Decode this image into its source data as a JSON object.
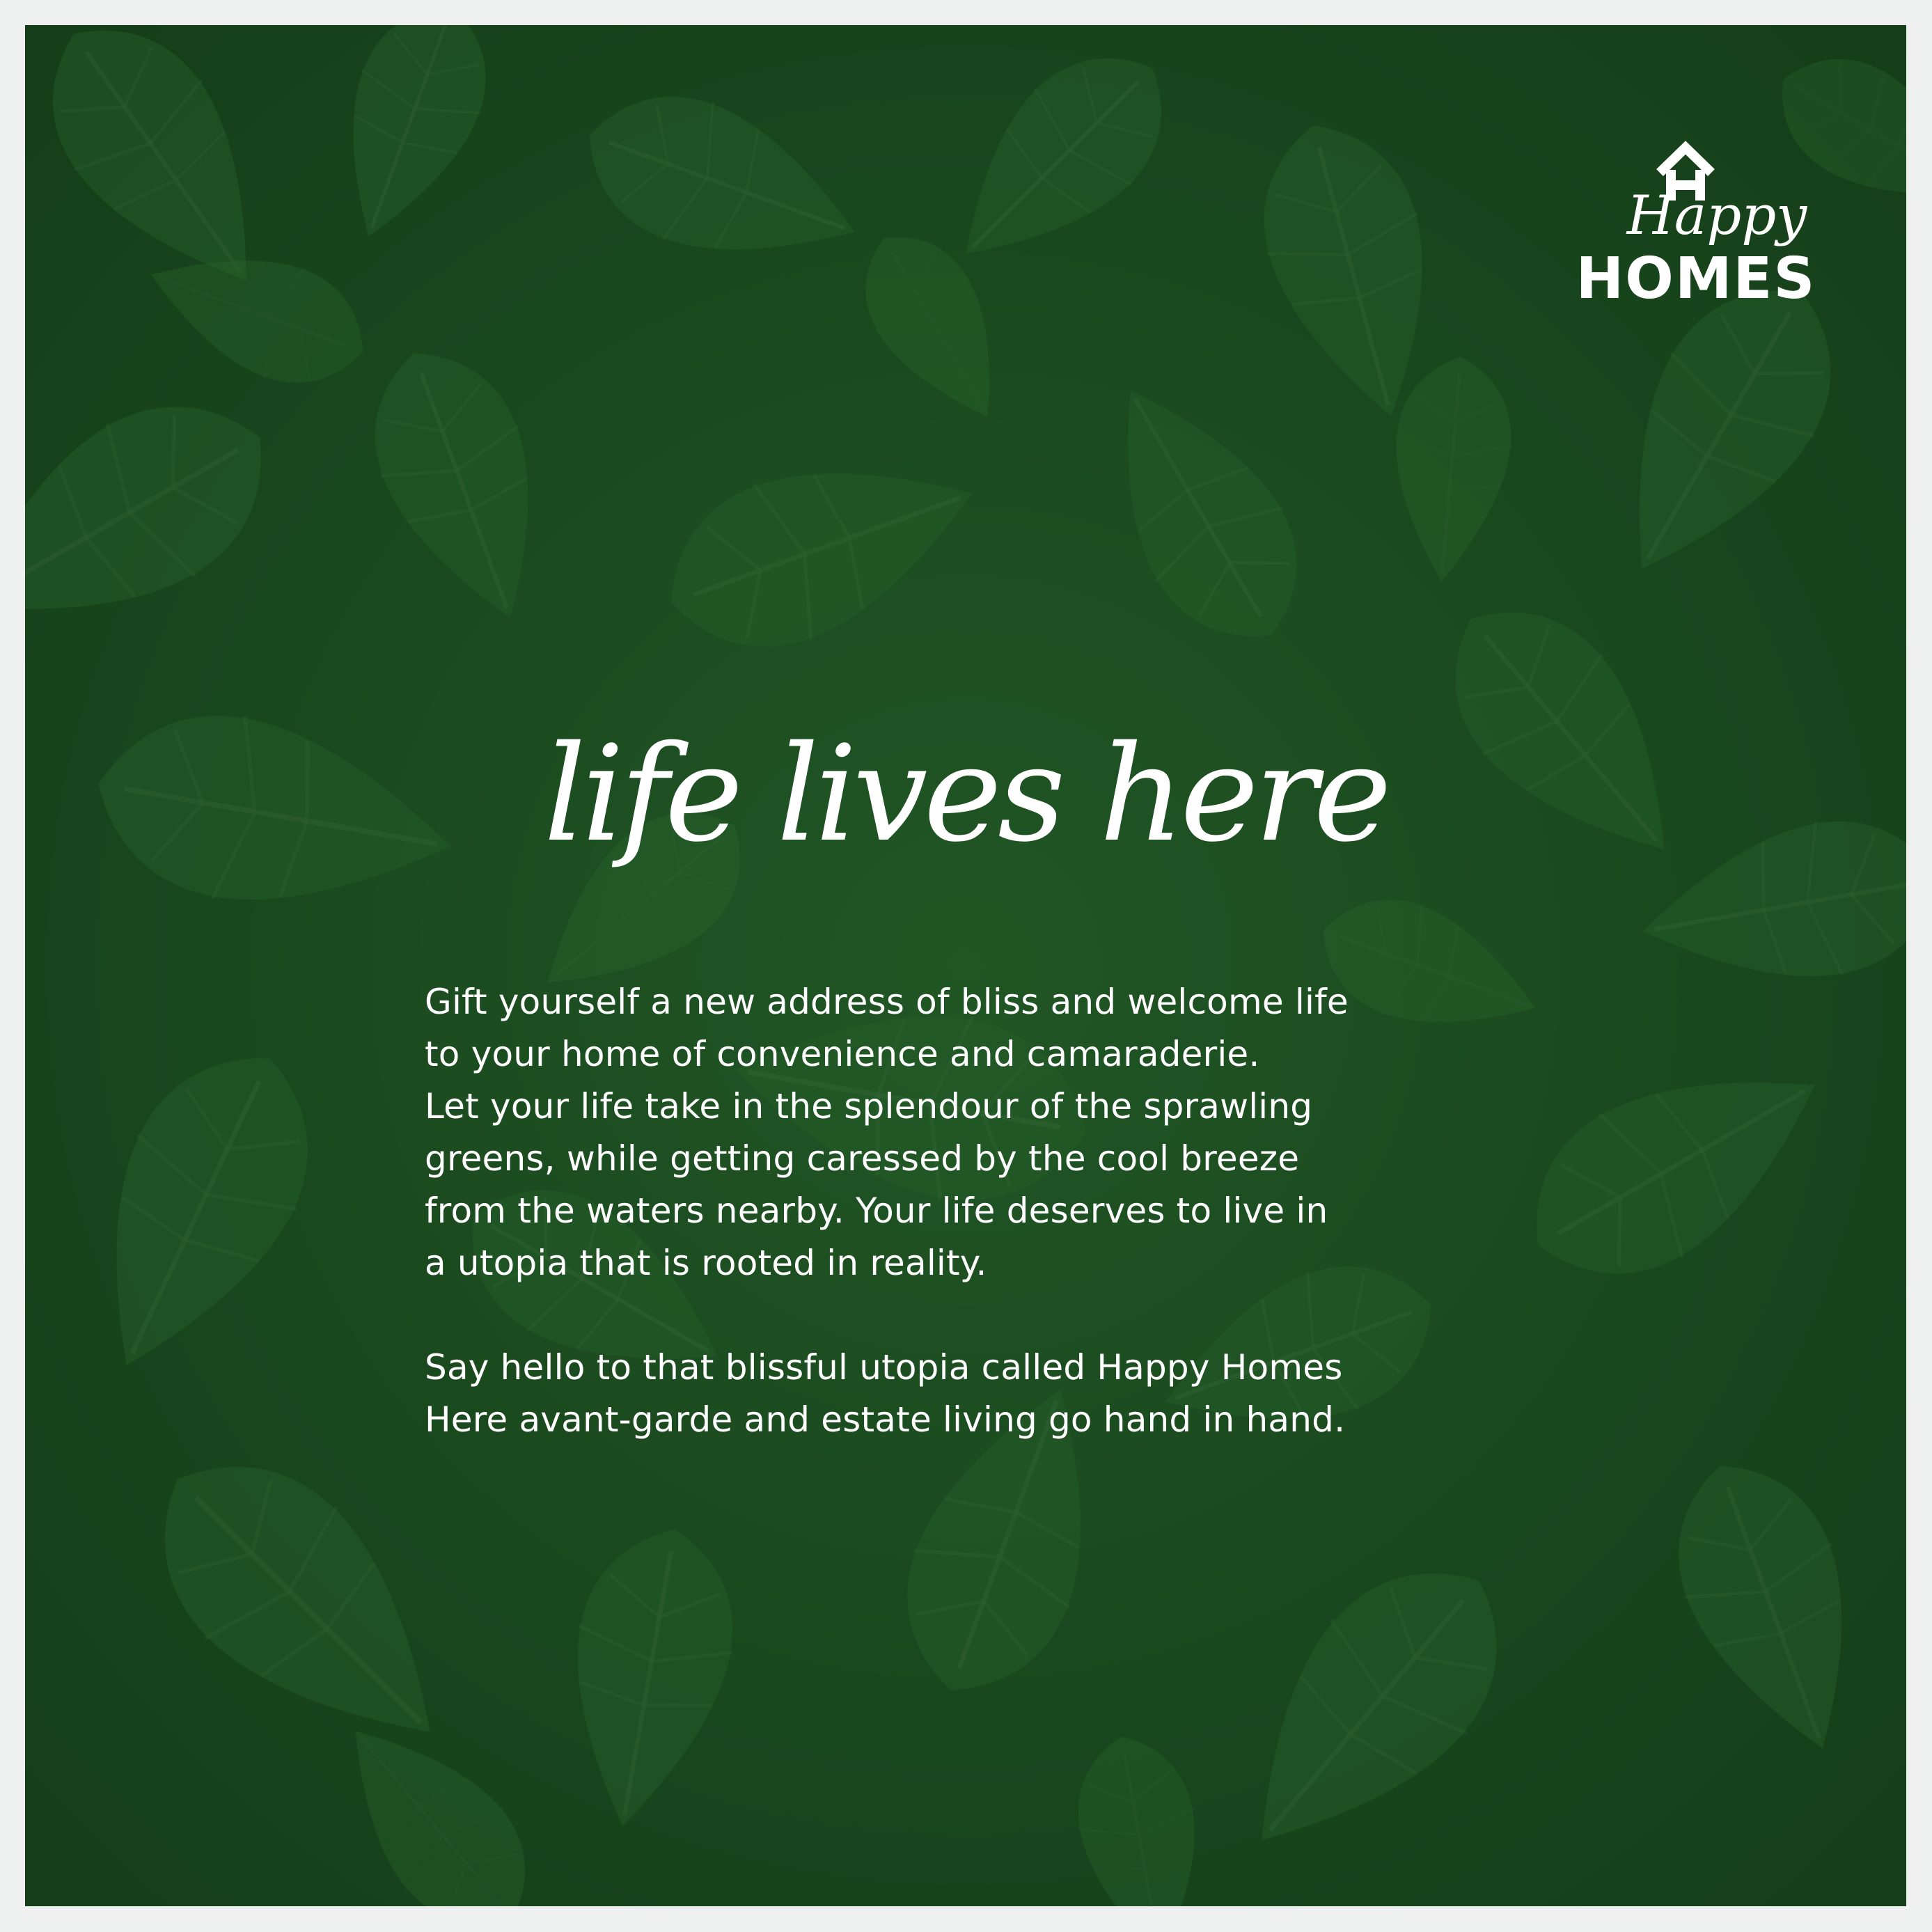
{
  "brand": {
    "script_word": "Happy",
    "wordmark": "HOMES",
    "accent_color": "#1d4f22",
    "text_color": "#ffffff"
  },
  "tagline": "life lives here",
  "body": {
    "paragraph1_lines": [
      "Gift yourself a new address of bliss and welcome life",
      "to your home of convenience and camaraderie.",
      "Let your life take in the splendour of the sprawling",
      "greens, while getting caressed by the cool breeze",
      "from the waters nearby. Your life deserves to live in",
      "a utopia that is rooted in reality."
    ],
    "paragraph2_lines": [
      "Say hello to that blissful utopia called Happy Homes",
      "Here avant-garde and estate living go hand in hand."
    ]
  }
}
